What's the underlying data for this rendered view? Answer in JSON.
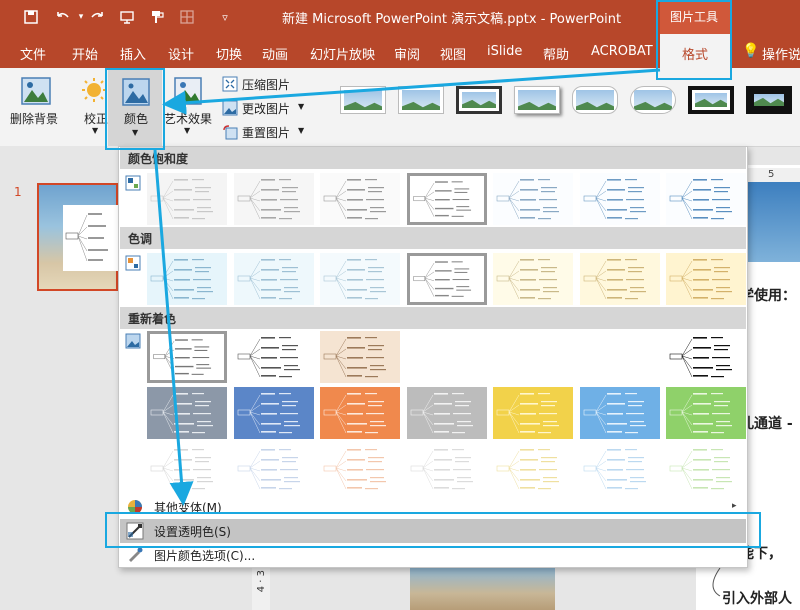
{
  "title_bar": {
    "document_title": "新建 Microsoft PowerPoint 演示文稿.pptx  -  PowerPoint",
    "contextual_group": "图片工具",
    "quick_access": [
      "save-icon",
      "undo-icon",
      "redo-icon",
      "present-icon",
      "format-painter-icon",
      "table-icon",
      "customize-icon"
    ]
  },
  "tabs": [
    "文件",
    "开始",
    "插入",
    "设计",
    "切换",
    "动画",
    "幻灯片放映",
    "审阅",
    "视图",
    "iSlide",
    "帮助",
    "ACROBAT",
    "格式",
    "操作说"
  ],
  "ribbon": {
    "remove_background": "删除背景",
    "corrections": "校正",
    "color": "颜色",
    "artistic_effects": "艺术效果",
    "compress": "压缩图片",
    "change": "更改图片",
    "reset": "重置图片"
  },
  "dropdown": {
    "section_saturation": "颜色饱和度",
    "section_tone": "色调",
    "section_recolor": "重新着色",
    "more_variations": "其他变体(M)",
    "set_transparent": "设置透明色(S)",
    "picture_color_options": "图片颜色选项(C)..."
  },
  "slide_panel": {
    "slide_number": "1"
  },
  "canvas": {
    "ruler_mark": "5",
    "text_1": "学使用：",
    "text_2": "孔通道 -",
    "text_3": "能下，",
    "text_4": "引入外部人"
  },
  "vertical_ruler": "4 · 3",
  "colors": {
    "accent": "#b7472a",
    "highlight": "#1aa8e0"
  }
}
